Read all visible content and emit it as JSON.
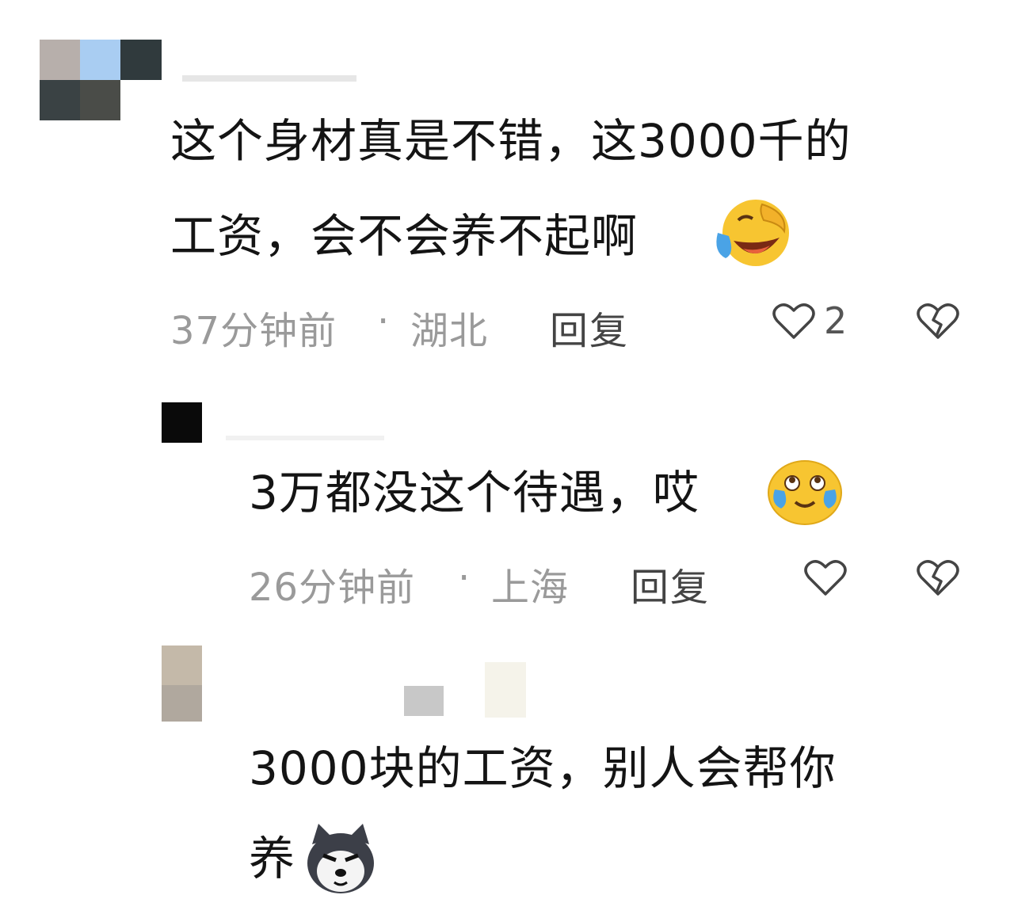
{
  "comments": [
    {
      "text_line1": "这个身材真是不错，这3000千的",
      "text_line2": "工资，会不会养不起啊",
      "emoji": "laughing-crying-face",
      "time": "37分钟前",
      "dot": "·",
      "location": "湖北",
      "reply_label": "回复",
      "likes": "2"
    },
    {
      "text_line1": "3万都没这个待遇，哎",
      "emoji": "tearful-face",
      "time": "26分钟前",
      "dot": "·",
      "location": "上海",
      "reply_label": "回复"
    },
    {
      "text_line1": "3000块的工资，别人会帮你",
      "text_line2": "养",
      "emoji": "shiba-dog-face"
    }
  ],
  "icons": {
    "like": "heart-outline-icon",
    "dislike": "broken-heart-icon"
  },
  "colors": {
    "text": "#141414",
    "meta": "#9a9a9a",
    "emoji_yellow": "#f7c531",
    "tears_blue": "#4aa3e6"
  }
}
